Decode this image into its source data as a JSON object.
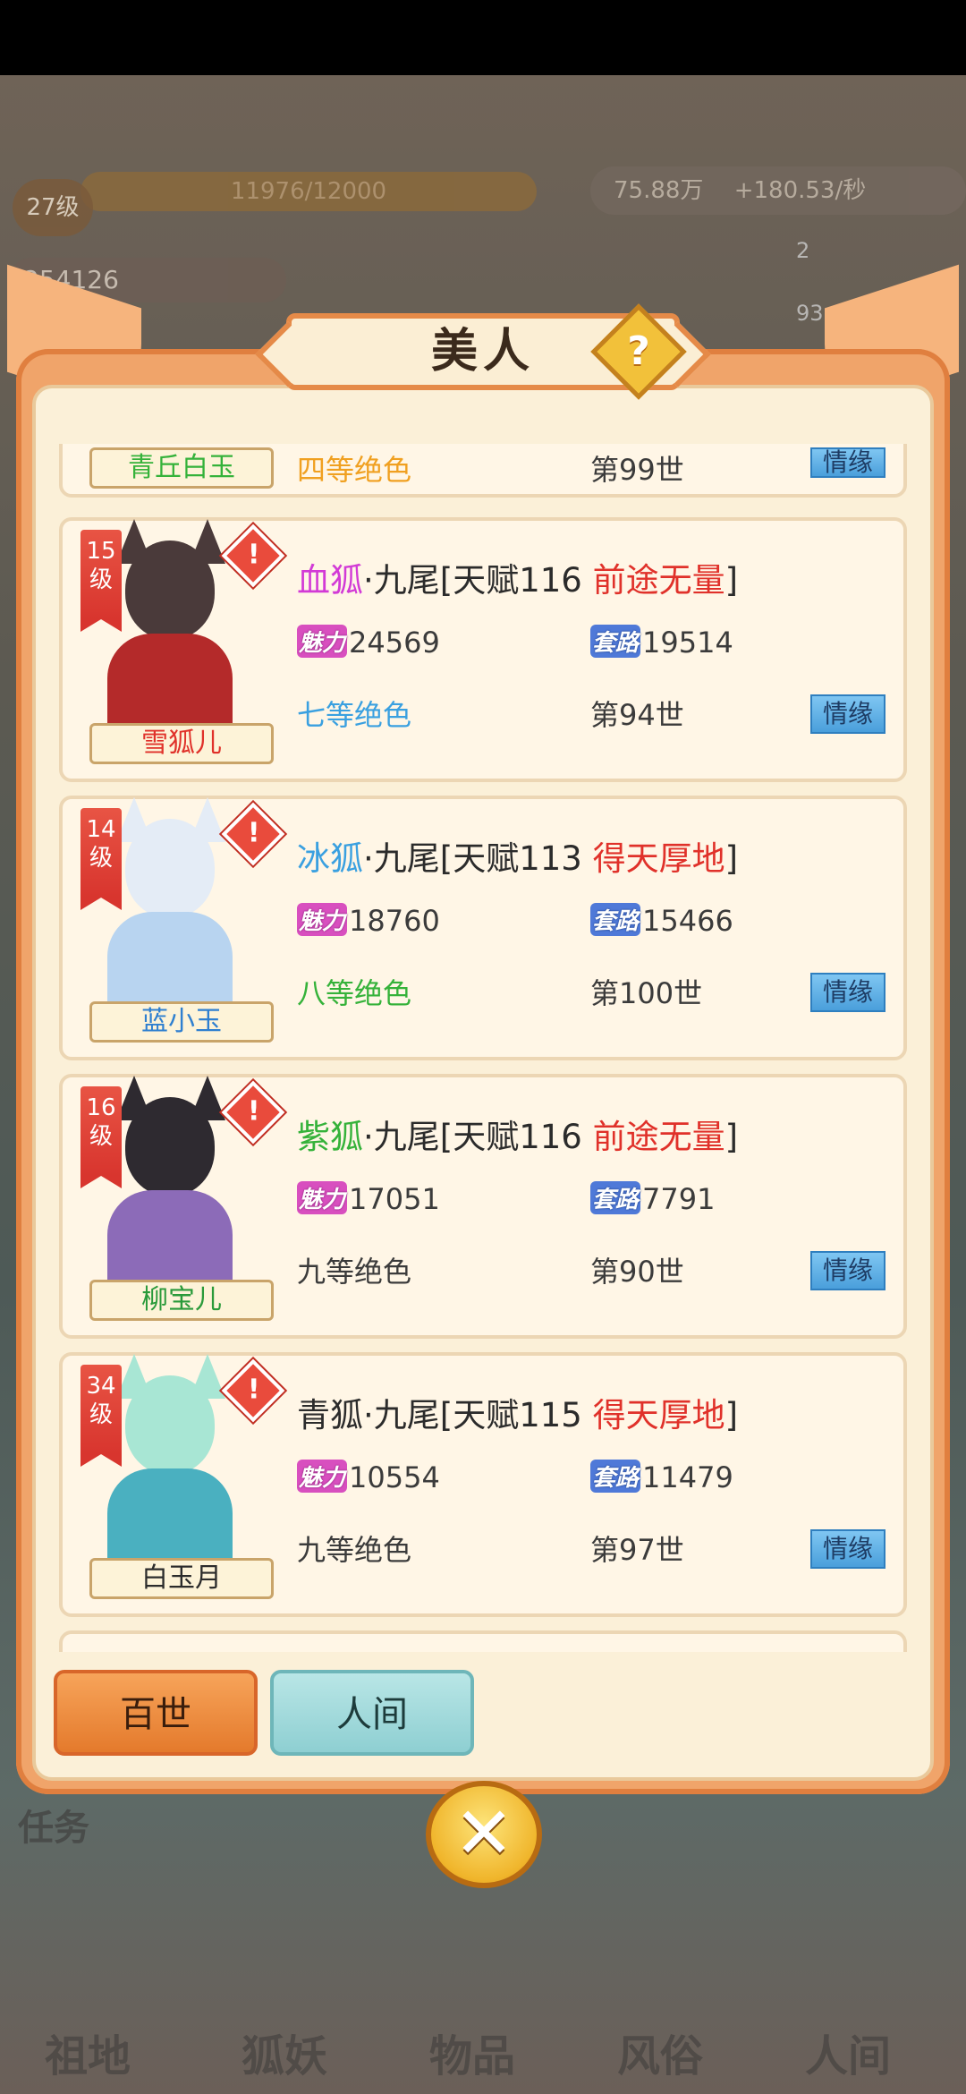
{
  "hud": {
    "level": "27级",
    "exp": "11976/12000",
    "resource_amount": "75.88万",
    "resource_rate": "+180.53/秒",
    "charm_total": "254126",
    "side_count_1": "2",
    "side_count_2": "93",
    "task_label": "任务",
    "nav": [
      "祖地",
      "狐妖",
      "物品",
      "风俗",
      "人间"
    ]
  },
  "dialog": {
    "title": "美人",
    "help_symbol": "?",
    "close_symbol": "✕"
  },
  "partial_top": {
    "name": "青丘白玉",
    "grade": "四等绝色",
    "gen": "第99世",
    "romance_label": "情缘"
  },
  "beauties": [
    {
      "level": "15级",
      "name": "雪狐儿",
      "race": "血狐",
      "race_color": "#d23ad6",
      "title_mid": "·九尾[天赋116 ",
      "talent_desc": "前途无量",
      "title_end": "]",
      "charm": "24569",
      "skill": "19514",
      "grade": "七等绝色",
      "grade_color": "#3aa0e0",
      "gen": "第94世",
      "romance_label": "情缘",
      "hair_color": "#4a3a3a",
      "body_color": "#b42a2a"
    },
    {
      "level": "14级",
      "name": "蓝小玉",
      "race": "冰狐",
      "race_color": "#3aa0e0",
      "title_mid": "·九尾[天赋113 ",
      "talent_desc": "得天厚地",
      "title_end": "]",
      "charm": "18760",
      "skill": "15466",
      "grade": "八等绝色",
      "grade_color": "#35b23a",
      "gen": "第100世",
      "romance_label": "情缘",
      "hair_color": "#e4ecf6",
      "body_color": "#b8d4f0"
    },
    {
      "level": "16级",
      "name": "柳宝儿",
      "race": "紫狐",
      "race_color": "#35b23a",
      "title_mid": "·九尾[天赋116 ",
      "talent_desc": "前途无量",
      "title_end": "]",
      "charm": "17051",
      "skill": "7791",
      "grade": "九等绝色",
      "grade_color": "#3b3b3b",
      "gen": "第90世",
      "romance_label": "情缘",
      "hair_color": "#2e2a30",
      "body_color": "#8c6bb8"
    },
    {
      "level": "34级",
      "name": "白玉月",
      "race": "青狐",
      "race_color": "#2b2b2b",
      "title_mid": "·九尾[天赋115 ",
      "talent_desc": "得天厚地",
      "title_end": "]",
      "charm": "10554",
      "skill": "11479",
      "grade": "九等绝色",
      "grade_color": "#3b3b3b",
      "gen": "第97世",
      "romance_label": "情缘",
      "hair_color": "#a8e6d4",
      "body_color": "#4ab0c0"
    }
  ],
  "stat_icons": {
    "charm": "魅力",
    "skill": "套路"
  },
  "tabs": {
    "active": "百世",
    "inactive": "人间"
  }
}
